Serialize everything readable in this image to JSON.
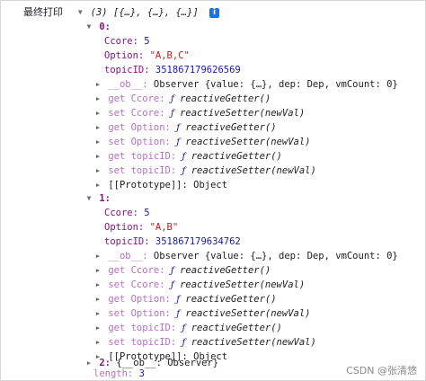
{
  "header": {
    "label": "最终打印",
    "summary": "(3) [{…}, {…}, {…}]",
    "info_icon": "i"
  },
  "items": [
    {
      "index": "0:",
      "ccore_key": "Ccore:",
      "ccore_val": "5",
      "option_key": "Option:",
      "option_val": "\"A,B,C\"",
      "topic_key": "topicID:",
      "topic_val": "351867179626569",
      "ob_key": "__ob__:",
      "ob_val": "Observer {value: {…}, dep: Dep, vmCount: 0}",
      "get_ccore_key": "get Ccore:",
      "get_ccore_val": "reactiveGetter()",
      "set_ccore_key": "set Ccore:",
      "set_ccore_val": "reactiveSetter(newVal)",
      "get_option_key": "get Option:",
      "get_option_val": "reactiveGetter()",
      "set_option_key": "set Option:",
      "set_option_val": "reactiveSetter(newVal)",
      "get_topic_key": "get topicID:",
      "get_topic_val": "reactiveGetter()",
      "set_topic_key": "set topicID:",
      "set_topic_val": "reactiveSetter(newVal)",
      "proto": "[[Prototype]]: Object"
    },
    {
      "index": "1:",
      "ccore_key": "Ccore:",
      "ccore_val": "5",
      "option_key": "Option:",
      "option_val": "\"A,B\"",
      "topic_key": "topicID:",
      "topic_val": "351867179634762",
      "ob_key": "__ob__:",
      "ob_val": "Observer {value: {…}, dep: Dep, vmCount: 0}",
      "get_ccore_key": "get Ccore:",
      "get_ccore_val": "reactiveGetter()",
      "set_ccore_key": "set Ccore:",
      "set_ccore_val": "reactiveSetter(newVal)",
      "get_option_key": "get Option:",
      "get_option_val": "reactiveGetter()",
      "set_option_key": "set Option:",
      "set_option_val": "reactiveSetter(newVal)",
      "get_topic_key": "get topicID:",
      "get_topic_val": "reactiveGetter()",
      "set_topic_key": "set topicID:",
      "set_topic_val": "reactiveSetter(newVal)",
      "proto": "[[Prototype]]: Object"
    }
  ],
  "item2": {
    "index": "2:",
    "value": "{__ob__: Observer}"
  },
  "length_row": {
    "key": "length:",
    "value": "3"
  },
  "f_glyph": "ƒ",
  "watermark": "CSDN @张清悠",
  "colors": {
    "key": "#881280",
    "string": "#c41a16",
    "number": "#1a1aa6",
    "accessor": "#b66fc0"
  }
}
